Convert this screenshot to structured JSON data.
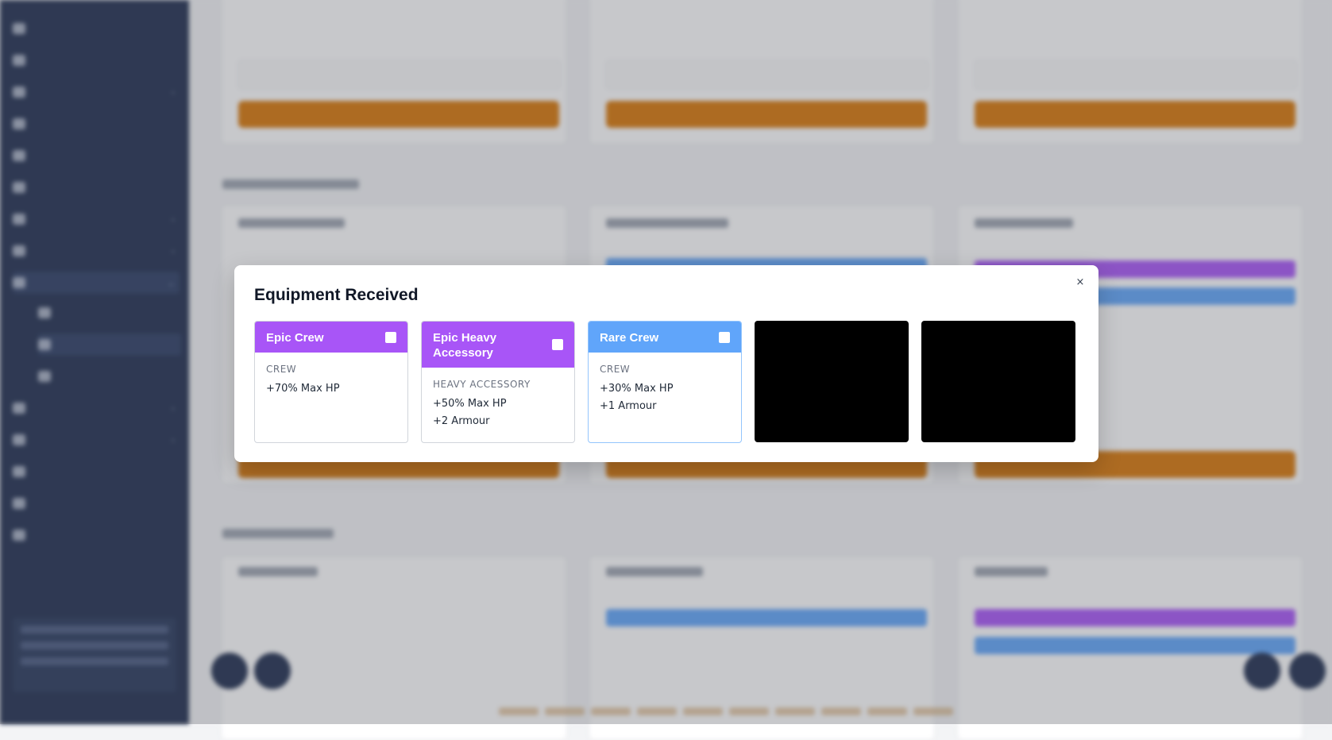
{
  "modal": {
    "title": "Equipment Received",
    "close_label": "×",
    "cards": [
      {
        "name": "Epic Crew",
        "type": "CREW",
        "stats": [
          "+70% Max HP"
        ],
        "rarity_color": "#a855f7"
      },
      {
        "name": "Epic Heavy Accessory",
        "type": "HEAVY ACCESSORY",
        "stats": [
          "+50% Max HP",
          "+2 Armour"
        ],
        "rarity_color": "#a855f7"
      },
      {
        "name": "Rare Crew",
        "type": "CREW",
        "stats": [
          "+30% Max HP",
          "+1 Armour"
        ],
        "rarity_color": "#60a5fa"
      }
    ]
  },
  "colors": {
    "sidebar": "#1f2d4e",
    "button_orange": "#d97706",
    "epic": "#a855f7",
    "rare": "#60a5fa"
  }
}
